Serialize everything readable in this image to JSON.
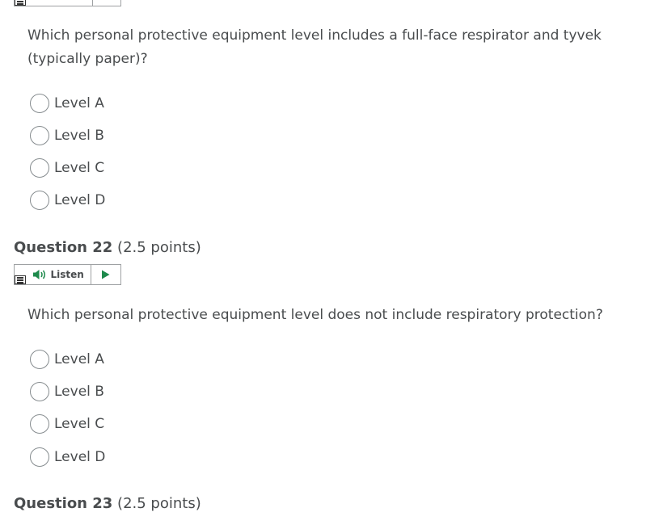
{
  "listen_label": "Listen",
  "accent_color": "#1e8a4c",
  "question_21": {
    "text": "Which personal protective equipment level includes a full-face respirator and tyvek (typically paper)?",
    "options": [
      "Level A",
      "Level B",
      "Level C",
      "Level D"
    ]
  },
  "question_22": {
    "title": "Question 22",
    "points": "(2.5 points)",
    "text": "Which personal protective equipment level does not include respiratory protection?",
    "options": [
      "Level A",
      "Level B",
      "Level C",
      "Level D"
    ]
  },
  "question_23": {
    "title": "Question 23",
    "points": "(2.5 points)"
  }
}
